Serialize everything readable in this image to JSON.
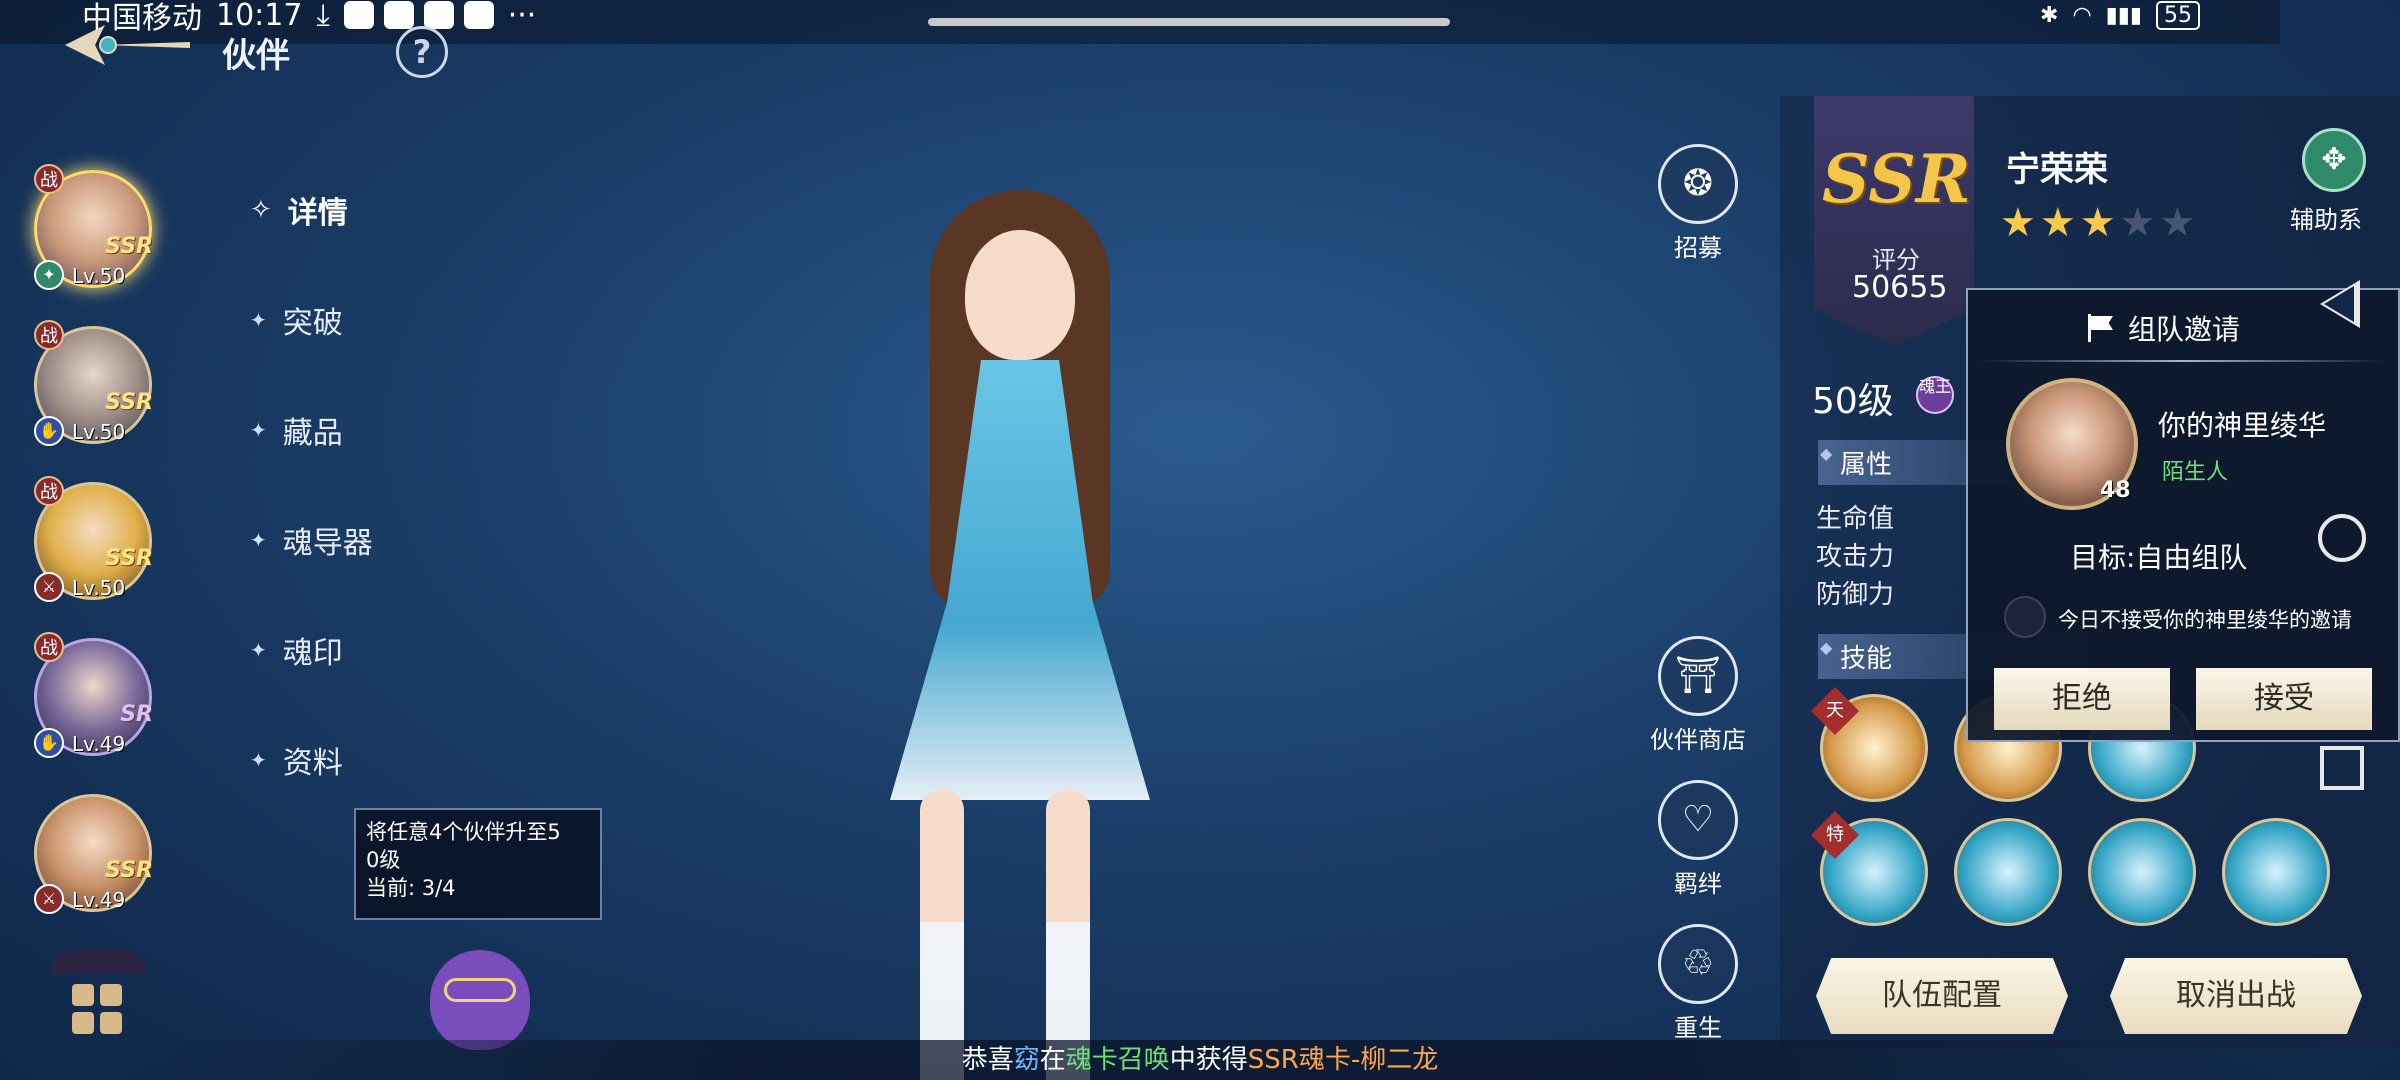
{
  "status": {
    "carrier": "中国移动",
    "time": "10:17",
    "more": "···",
    "battery": "55"
  },
  "header": {
    "title": "伙伴",
    "help": "?"
  },
  "partners": [
    {
      "tag": "战",
      "rarity": "SSR",
      "level": "Lv.50"
    },
    {
      "tag": "战",
      "rarity": "SSR",
      "level": "Lv.50"
    },
    {
      "tag": "战",
      "rarity": "SSR",
      "level": "Lv.50"
    },
    {
      "tag": "战",
      "rarity": "SR",
      "level": "Lv.49"
    },
    {
      "tag": "",
      "rarity": "SSR",
      "level": "Lv.49"
    }
  ],
  "nav": [
    {
      "label": "详情"
    },
    {
      "label": "突破"
    },
    {
      "label": "藏品"
    },
    {
      "label": "魂导器"
    },
    {
      "label": "魂印"
    },
    {
      "label": "资料"
    }
  ],
  "task": {
    "line1": "将任意4个伙伴升至5",
    "line2": "0级",
    "progress": "当前: 3/4"
  },
  "actions": [
    {
      "label": "招募"
    },
    {
      "label": "伙伴商店"
    },
    {
      "label": "羁绊"
    },
    {
      "label": "重生"
    }
  ],
  "detail": {
    "rarity": "SSR",
    "score_label": "评分",
    "score": "50655",
    "name": "宁荣荣",
    "stars_filled": 3,
    "stars_total": 5,
    "role": "辅助系",
    "level": "50级",
    "soul_king": "魂王",
    "section_attr": "属性",
    "attrs": [
      "生命值",
      "攻击力",
      "防御力"
    ],
    "section_skill": "技能",
    "skill_tag_1": "天",
    "skill_tag_2": "特",
    "btn_team": "队伍配置",
    "btn_cancel": "取消出战"
  },
  "invite": {
    "title": "组队邀请",
    "player_name": "你的神里绫华",
    "relation": "陌生人",
    "player_level": "48",
    "goal": "目标:自由组队",
    "refuse_today": "今日不接受你的神里绫华的邀请",
    "reject": "拒绝",
    "accept": "接受"
  },
  "ticker": {
    "prefix": "恭喜",
    "player": "窈",
    "mid": "在",
    "event": "魂卡召唤",
    "mid2": "中获得",
    "item": "SSR魂卡-柳二龙"
  }
}
